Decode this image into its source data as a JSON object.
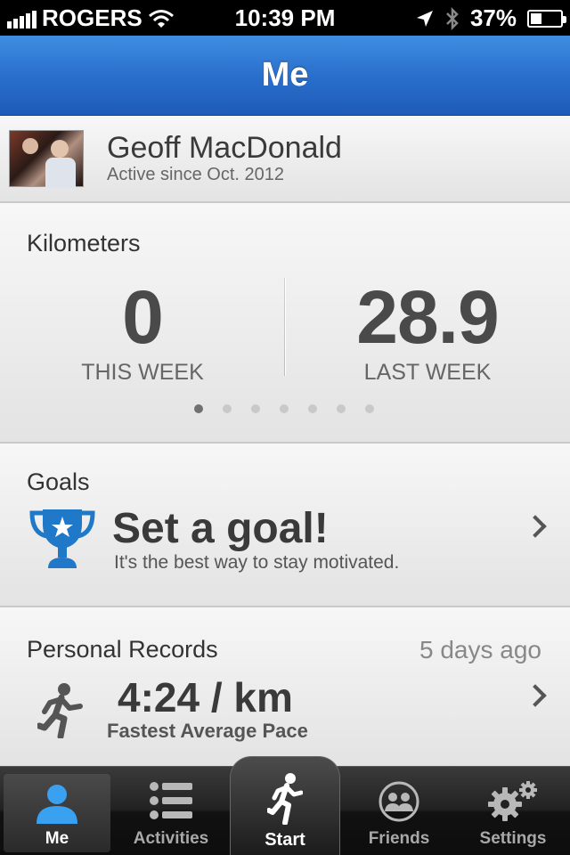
{
  "status_bar": {
    "carrier": "ROGERS",
    "time": "10:39 PM",
    "battery_percent": "37%",
    "battery_level": 0.37,
    "icons": [
      "signal-icon",
      "wifi-icon",
      "location-icon",
      "bluetooth-icon",
      "battery-charging-icon"
    ]
  },
  "nav": {
    "title": "Me"
  },
  "profile": {
    "name": "Geoff MacDonald",
    "since": "Active since Oct. 2012"
  },
  "stats": {
    "label": "Kilometers",
    "this_week_value": "0",
    "this_week_label": "THIS WEEK",
    "last_week_value": "28.9",
    "last_week_label": "LAST WEEK",
    "page_count": 7,
    "active_page": 1
  },
  "goals": {
    "label": "Goals",
    "title": "Set a goal!",
    "subtitle": "It's the best way to stay motivated.",
    "icon": "trophy-icon",
    "accent": "#1f78c8"
  },
  "records": {
    "label": "Personal Records",
    "time_ago": "5 days ago",
    "value": "4:24 / km",
    "caption": "Fastest Average Pace",
    "icon": "runner-icon"
  },
  "tabs": [
    {
      "label": "Me",
      "icon": "person-icon",
      "active": true
    },
    {
      "label": "Activities",
      "icon": "list-icon",
      "active": false
    },
    {
      "label": "Start",
      "icon": "runner-icon",
      "active": false
    },
    {
      "label": "Friends",
      "icon": "friends-icon",
      "active": false
    },
    {
      "label": "Settings",
      "icon": "gears-icon",
      "active": false
    }
  ]
}
